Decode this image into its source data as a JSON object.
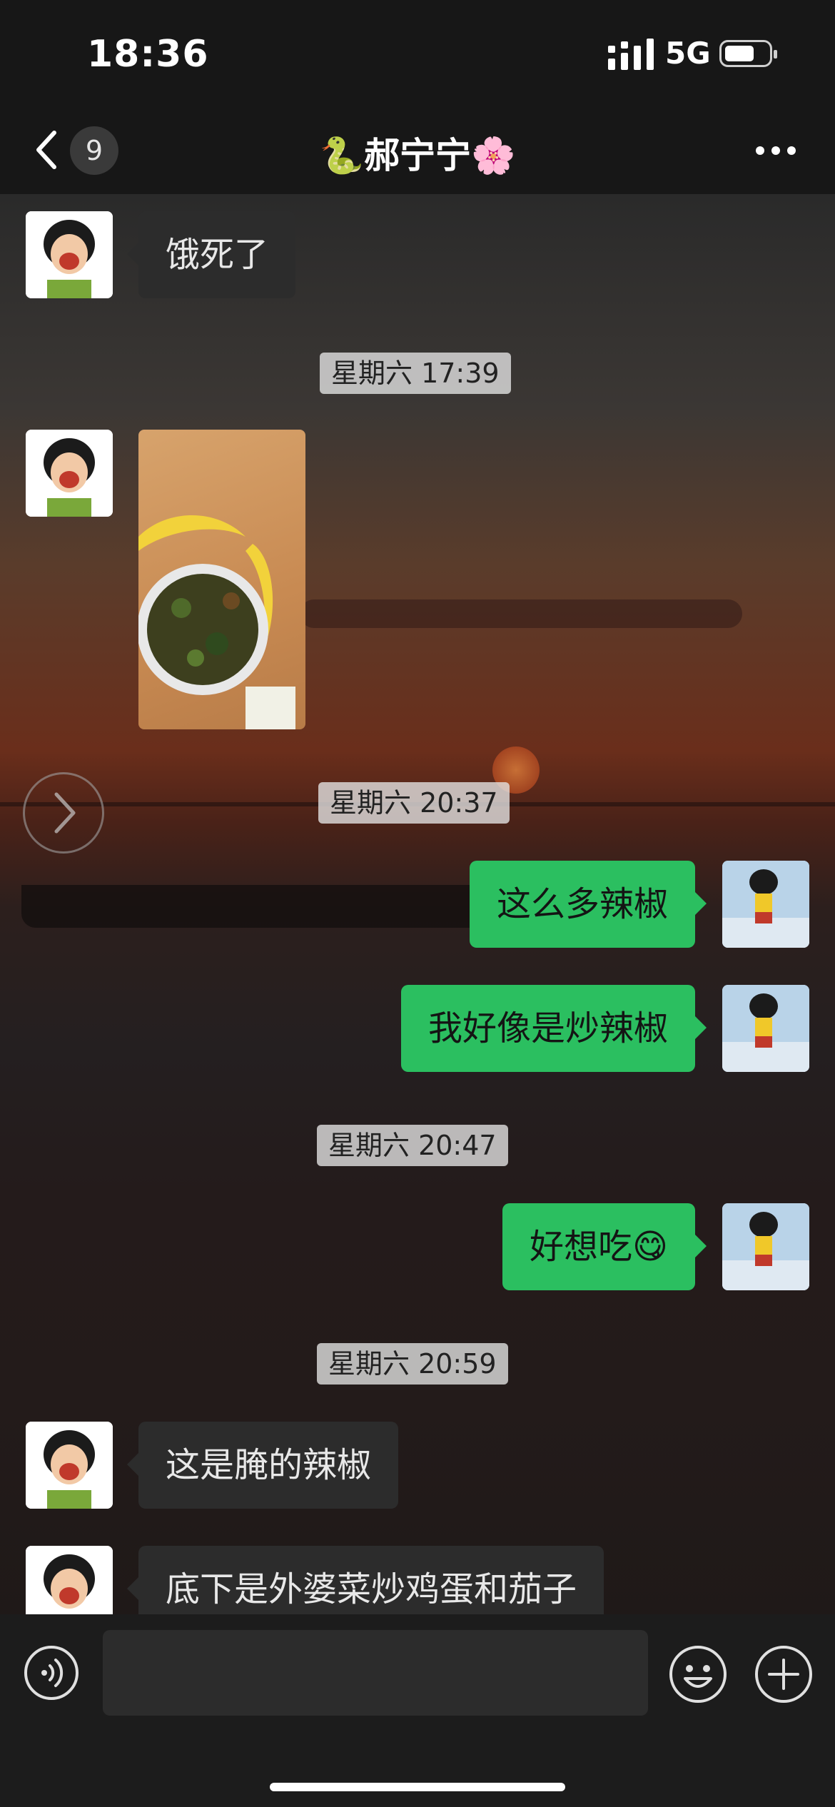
{
  "status_bar": {
    "time": "18:36",
    "network": "5G"
  },
  "nav": {
    "unread_count": "9",
    "title": "🐍郝宁宁🌸"
  },
  "messages": [
    {
      "type": "text",
      "from": "contact",
      "text": "饿死了"
    },
    {
      "type": "timestamp",
      "text": "星期六 17:39"
    },
    {
      "type": "image",
      "from": "contact"
    },
    {
      "type": "timestamp",
      "text": "星期六 20:37"
    },
    {
      "type": "text",
      "from": "me",
      "text": "这么多辣椒"
    },
    {
      "type": "text",
      "from": "me",
      "text": "我好像是炒辣椒"
    },
    {
      "type": "timestamp",
      "text": "星期六 20:47"
    },
    {
      "type": "text",
      "from": "me",
      "text": "好想吃😋"
    },
    {
      "type": "timestamp",
      "text": "星期六 20:59"
    },
    {
      "type": "text",
      "from": "contact",
      "text": "这是腌的辣椒"
    },
    {
      "type": "text",
      "from": "contact",
      "text": "底下是外婆菜炒鸡蛋和茄子"
    }
  ],
  "input": {
    "placeholder": ""
  },
  "icons": {
    "back": "chevron-left-icon",
    "more": "more-icon",
    "voice": "voice-icon",
    "emoji": "emoji-icon",
    "plus": "plus-icon",
    "forward": "chevron-right-icon"
  },
  "colors": {
    "outgoing_bubble": "#2bbf60",
    "incoming_bubble": "#2c2c2c",
    "background": "#171717"
  }
}
